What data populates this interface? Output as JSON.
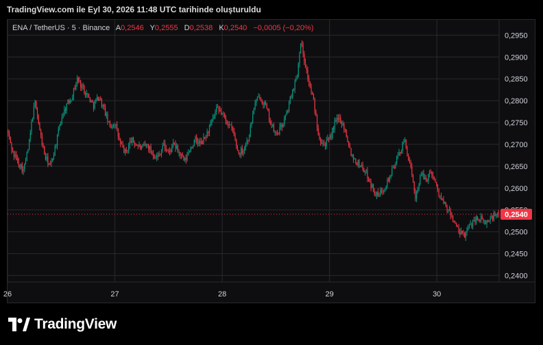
{
  "header": {
    "title": "TradingView.com ile Eyl 30, 2026 11:48 UTC tarihinde oluşturuldu"
  },
  "legend": {
    "symbol": "ENA / TetherUS · 5 · Binance",
    "o_label": "A",
    "o_value": "0,2546",
    "h_label": "Y",
    "h_value": "0,2555",
    "l_label": "D",
    "l_value": "0,2538",
    "c_label": "K",
    "c_value": "0,2540",
    "change": "−0,0005 (−0,20%)"
  },
  "colors": {
    "up": "#089981",
    "down": "#f23645",
    "grid": "#2a2a2e",
    "price_tag": "#f23645"
  },
  "icons": {
    "brand": "tradingview-logo-icon"
  },
  "footer": {
    "brand": "TradingView"
  },
  "chart_data": {
    "type": "candlestick",
    "symbol": "ENA / TetherUS",
    "interval": "5",
    "exchange": "Binance",
    "y_ticks": [
      "0,2950",
      "0,2900",
      "0,2850",
      "0,2800",
      "0,2750",
      "0,2700",
      "0,2650",
      "0,2600",
      "0,2550",
      "0,2500",
      "0,2450",
      "0,2400"
    ],
    "y_tick_values": [
      0.295,
      0.29,
      0.285,
      0.28,
      0.275,
      0.27,
      0.265,
      0.26,
      0.255,
      0.25,
      0.245,
      0.24
    ],
    "x_ticks": [
      "26",
      "27",
      "28",
      "29",
      "30"
    ],
    "x_tick_days": [
      26,
      27,
      28,
      29,
      30
    ],
    "ylim": [
      0.2385,
      0.2985
    ],
    "xlim": [
      26.0,
      30.58
    ],
    "last_price": 0.254,
    "last_price_label": "0,2540",
    "close_path": [
      [
        26.0,
        0.273
      ],
      [
        26.05,
        0.268
      ],
      [
        26.1,
        0.266
      ],
      [
        26.15,
        0.264
      ],
      [
        26.2,
        0.27
      ],
      [
        26.23,
        0.276
      ],
      [
        26.26,
        0.28
      ],
      [
        26.3,
        0.273
      ],
      [
        26.35,
        0.267
      ],
      [
        26.4,
        0.265
      ],
      [
        26.45,
        0.27
      ],
      [
        26.5,
        0.276
      ],
      [
        26.55,
        0.279
      ],
      [
        26.6,
        0.281
      ],
      [
        26.65,
        0.285
      ],
      [
        26.7,
        0.283
      ],
      [
        26.75,
        0.281
      ],
      [
        26.8,
        0.279
      ],
      [
        26.85,
        0.281
      ],
      [
        26.9,
        0.278
      ],
      [
        26.95,
        0.274
      ],
      [
        27.0,
        0.275
      ],
      [
        27.05,
        0.27
      ],
      [
        27.1,
        0.268
      ],
      [
        27.15,
        0.271
      ],
      [
        27.2,
        0.27
      ],
      [
        27.25,
        0.269
      ],
      [
        27.3,
        0.27
      ],
      [
        27.35,
        0.268
      ],
      [
        27.4,
        0.267
      ],
      [
        27.45,
        0.27
      ],
      [
        27.5,
        0.268
      ],
      [
        27.55,
        0.27
      ],
      [
        27.6,
        0.268
      ],
      [
        27.65,
        0.266
      ],
      [
        27.7,
        0.269
      ],
      [
        27.75,
        0.271
      ],
      [
        27.8,
        0.27
      ],
      [
        27.85,
        0.272
      ],
      [
        27.9,
        0.275
      ],
      [
        27.95,
        0.278
      ],
      [
        28.0,
        0.277
      ],
      [
        28.05,
        0.275
      ],
      [
        28.1,
        0.273
      ],
      [
        28.15,
        0.268
      ],
      [
        28.2,
        0.269
      ],
      [
        28.25,
        0.272
      ],
      [
        28.3,
        0.279
      ],
      [
        28.35,
        0.281
      ],
      [
        28.4,
        0.279
      ],
      [
        28.45,
        0.275
      ],
      [
        28.5,
        0.272
      ],
      [
        28.55,
        0.274
      ],
      [
        28.6,
        0.277
      ],
      [
        28.65,
        0.282
      ],
      [
        28.7,
        0.286
      ],
      [
        28.73,
        0.294
      ],
      [
        28.76,
        0.29
      ],
      [
        28.8,
        0.285
      ],
      [
        28.85,
        0.28
      ],
      [
        28.9,
        0.272
      ],
      [
        28.95,
        0.27
      ],
      [
        29.0,
        0.271
      ],
      [
        29.05,
        0.275
      ],
      [
        29.1,
        0.276
      ],
      [
        29.15,
        0.273
      ],
      [
        29.2,
        0.268
      ],
      [
        29.25,
        0.266
      ],
      [
        29.3,
        0.265
      ],
      [
        29.35,
        0.263
      ],
      [
        29.4,
        0.26
      ],
      [
        29.45,
        0.258
      ],
      [
        29.5,
        0.26
      ],
      [
        29.55,
        0.262
      ],
      [
        29.6,
        0.265
      ],
      [
        29.65,
        0.268
      ],
      [
        29.7,
        0.271
      ],
      [
        29.75,
        0.265
      ],
      [
        29.8,
        0.258
      ],
      [
        29.85,
        0.263
      ],
      [
        29.9,
        0.262
      ],
      [
        29.95,
        0.264
      ],
      [
        30.0,
        0.26
      ],
      [
        30.05,
        0.257
      ],
      [
        30.1,
        0.255
      ],
      [
        30.15,
        0.253
      ],
      [
        30.2,
        0.25
      ],
      [
        30.25,
        0.249
      ],
      [
        30.3,
        0.251
      ],
      [
        30.35,
        0.253
      ],
      [
        30.4,
        0.253
      ],
      [
        30.45,
        0.252
      ],
      [
        30.5,
        0.253
      ],
      [
        30.55,
        0.254
      ],
      [
        30.58,
        0.254
      ]
    ]
  }
}
